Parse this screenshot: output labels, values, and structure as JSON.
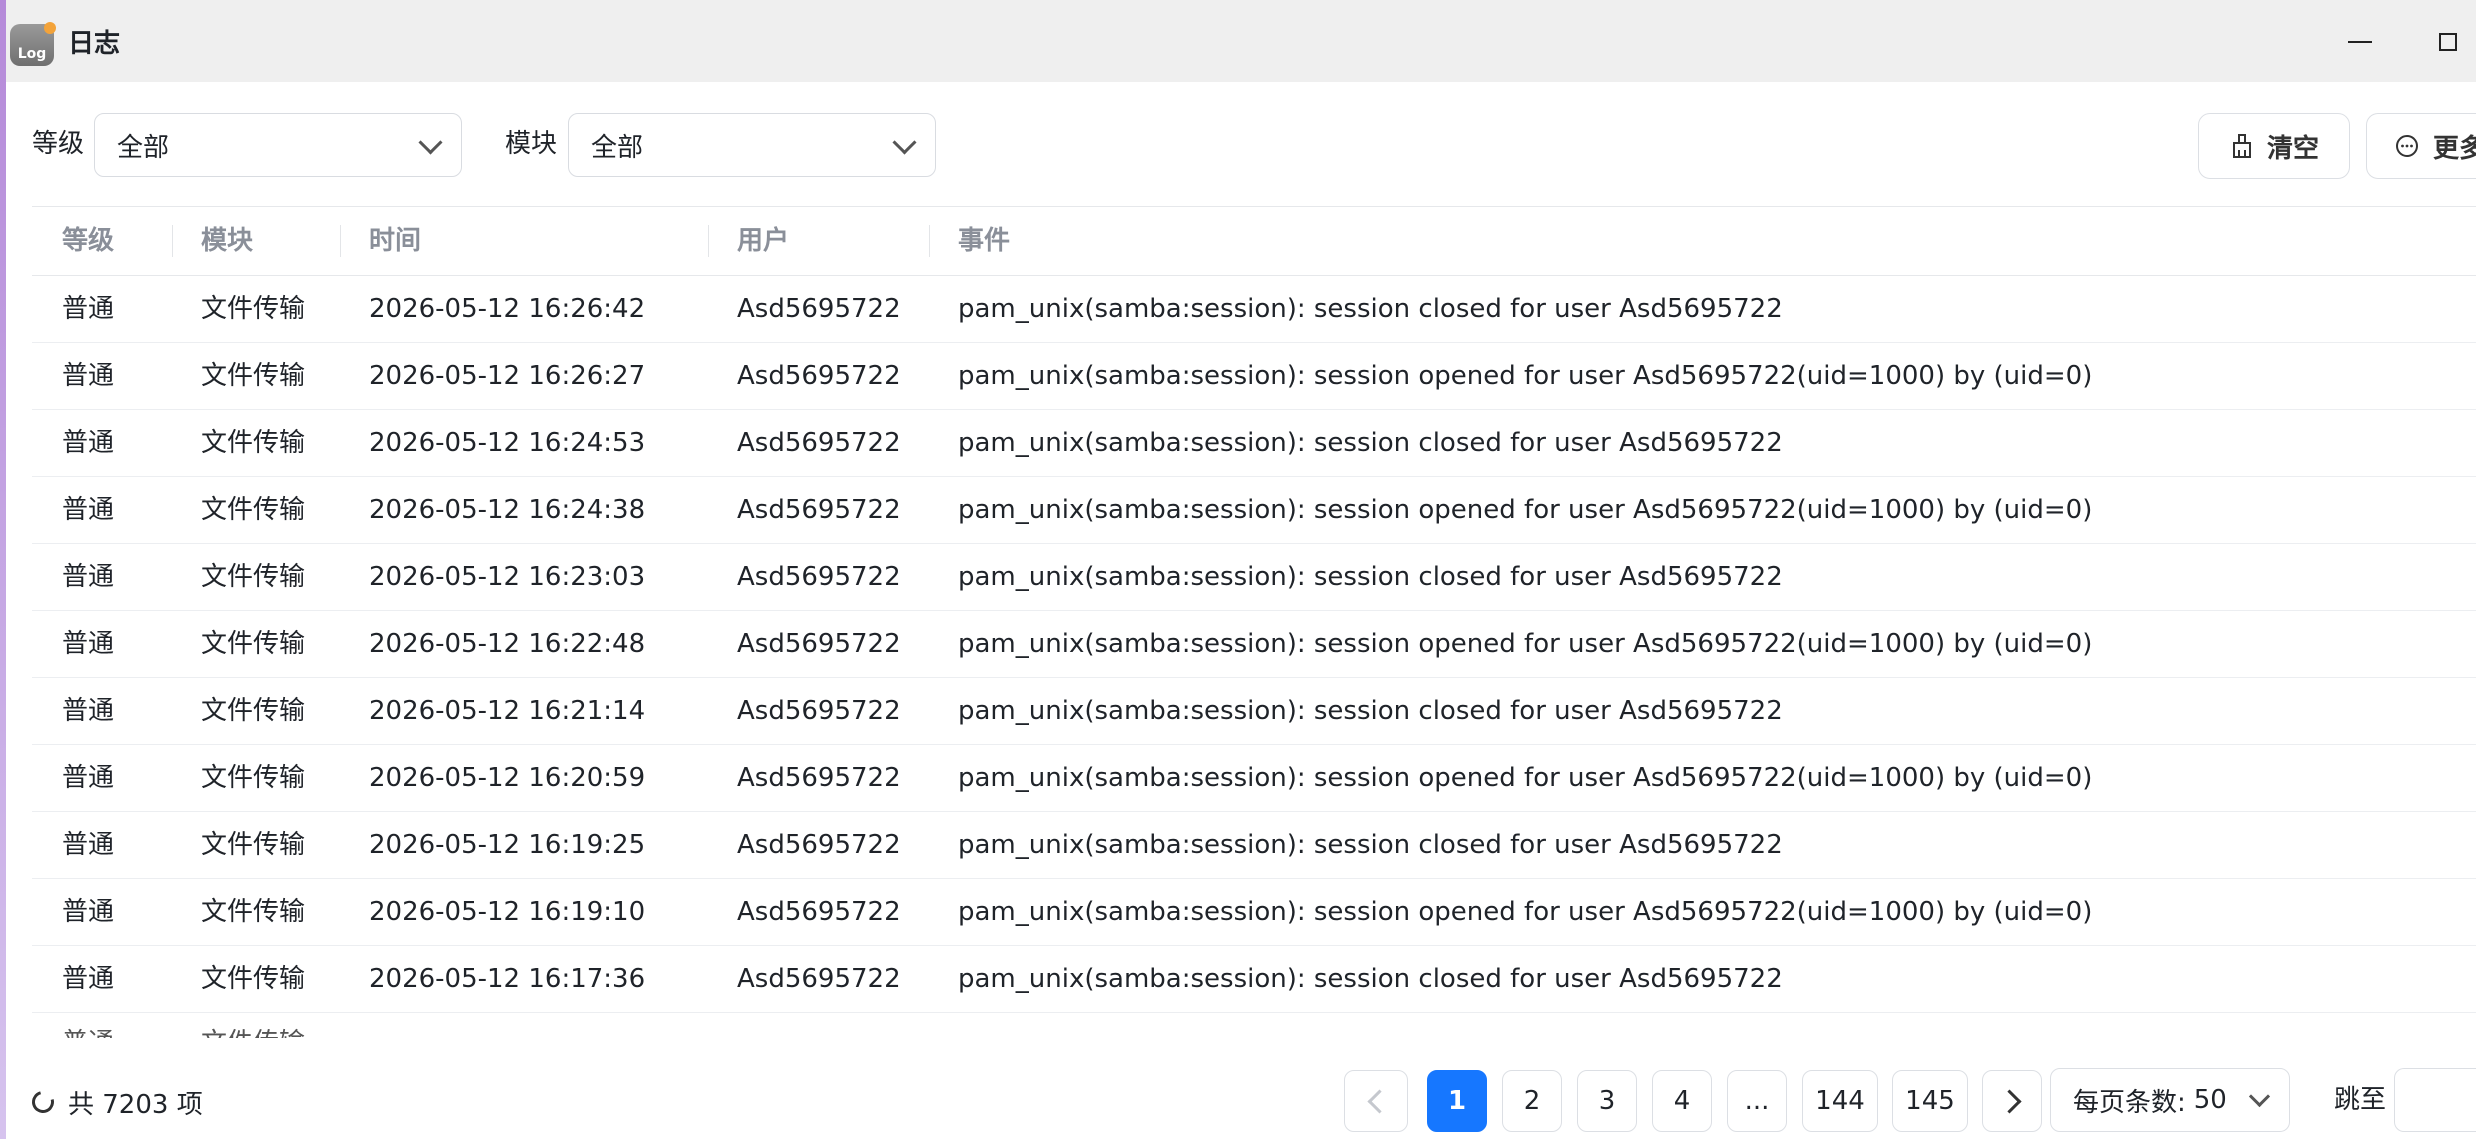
{
  "window": {
    "title": "日志",
    "app_icon_text": "Log"
  },
  "filters": {
    "level_label": "等级",
    "level_value": "全部",
    "module_label": "模块",
    "module_value": "全部"
  },
  "toolbar": {
    "clear_label": "清空",
    "more_label": "更多"
  },
  "table": {
    "headers": [
      "等级",
      "模块",
      "时间",
      "用户",
      "事件"
    ],
    "rows": [
      [
        "普通",
        "文件传输",
        "2026-05-12 16:26:42",
        "Asd5695722",
        "pam_unix(samba:session): session closed for user Asd5695722"
      ],
      [
        "普通",
        "文件传输",
        "2026-05-12 16:26:27",
        "Asd5695722",
        "pam_unix(samba:session): session opened for user Asd5695722(uid=1000) by (uid=0)"
      ],
      [
        "普通",
        "文件传输",
        "2026-05-12 16:24:53",
        "Asd5695722",
        "pam_unix(samba:session): session closed for user Asd5695722"
      ],
      [
        "普通",
        "文件传输",
        "2026-05-12 16:24:38",
        "Asd5695722",
        "pam_unix(samba:session): session opened for user Asd5695722(uid=1000) by (uid=0)"
      ],
      [
        "普通",
        "文件传输",
        "2026-05-12 16:23:03",
        "Asd5695722",
        "pam_unix(samba:session): session closed for user Asd5695722"
      ],
      [
        "普通",
        "文件传输",
        "2026-05-12 16:22:48",
        "Asd5695722",
        "pam_unix(samba:session): session opened for user Asd5695722(uid=1000) by (uid=0)"
      ],
      [
        "普通",
        "文件传输",
        "2026-05-12 16:21:14",
        "Asd5695722",
        "pam_unix(samba:session): session closed for user Asd5695722"
      ],
      [
        "普通",
        "文件传输",
        "2026-05-12 16:20:59",
        "Asd5695722",
        "pam_unix(samba:session): session opened for user Asd5695722(uid=1000) by (uid=0)"
      ],
      [
        "普通",
        "文件传输",
        "2026-05-12 16:19:25",
        "Asd5695722",
        "pam_unix(samba:session): session closed for user Asd5695722"
      ],
      [
        "普通",
        "文件传输",
        "2026-05-12 16:19:10",
        "Asd5695722",
        "pam_unix(samba:session): session opened for user Asd5695722(uid=1000) by (uid=0)"
      ],
      [
        "普通",
        "文件传输",
        "2026-05-12 16:17:36",
        "Asd5695722",
        "pam_unix(samba:session): session closed for user Asd5695722"
      ]
    ],
    "partial_row": [
      "普通",
      "文件传输"
    ]
  },
  "footer": {
    "total_text": "共 7203 项",
    "pages": [
      "1",
      "2",
      "3",
      "4",
      "...",
      "144",
      "145"
    ],
    "current_page": "1",
    "per_page_label": "每页条数:",
    "per_page_value": "50",
    "jump_label": "跳至",
    "jump_value": ""
  },
  "colors": {
    "accent": "#1677ff",
    "header_text": "#8a8f99",
    "titlebar": "#efefef"
  }
}
